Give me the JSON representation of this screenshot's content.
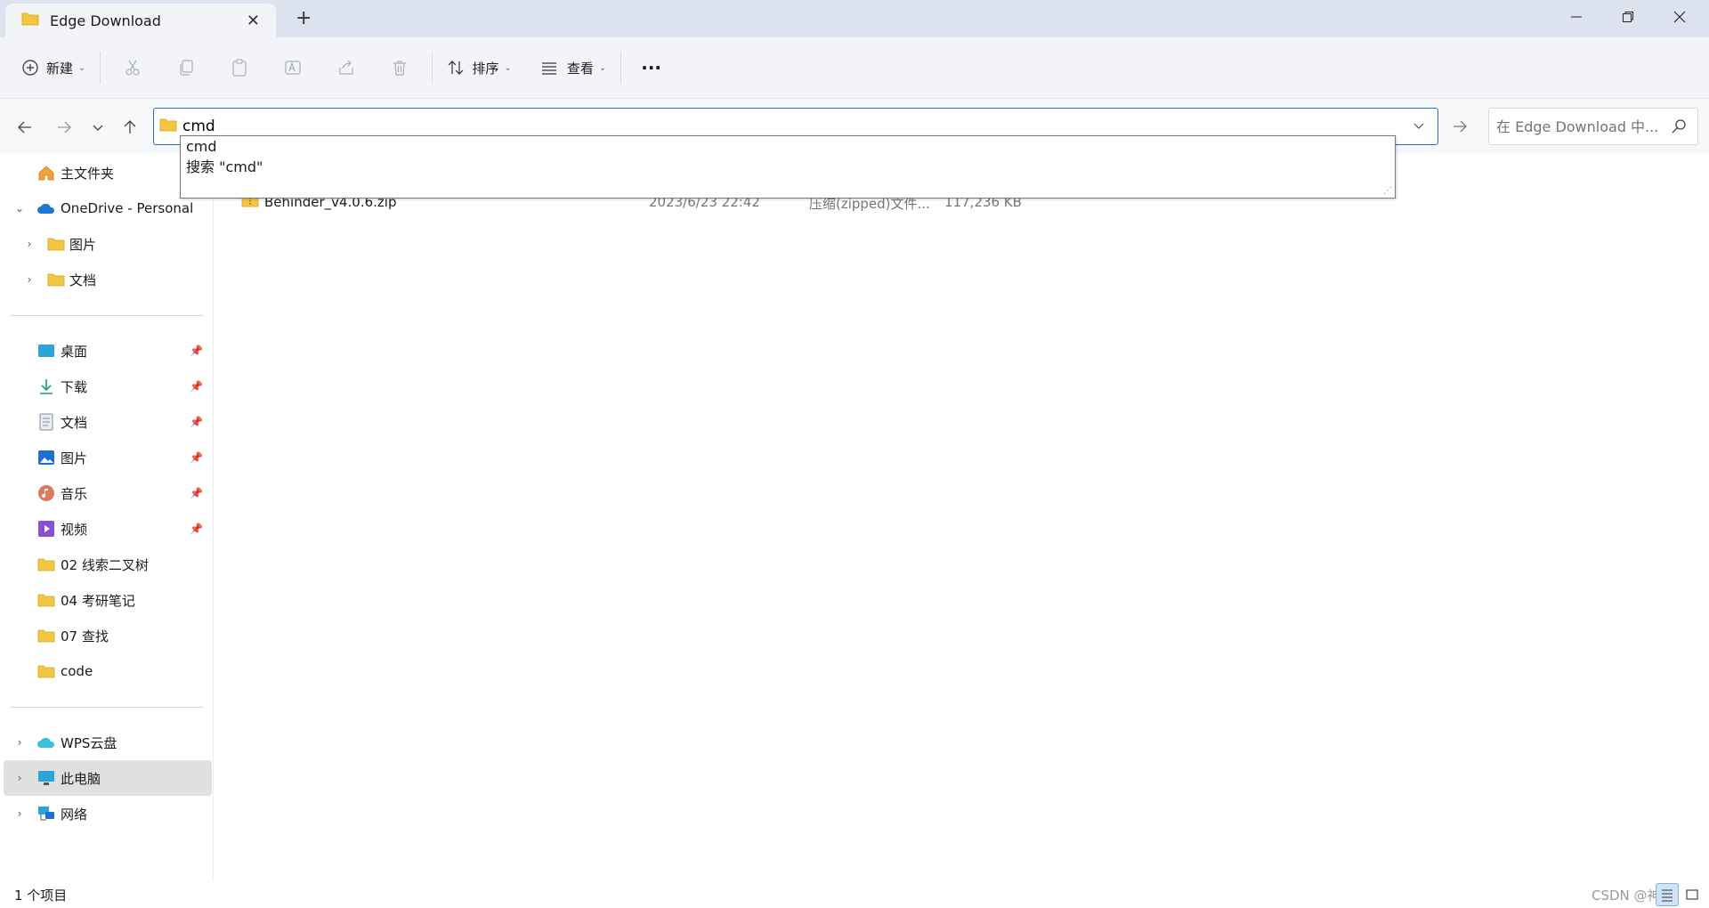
{
  "window": {
    "tab_title": "Edge Download",
    "new_tab_glyph": "+",
    "close_tab_glyph": "✕"
  },
  "toolbar": {
    "new_label": "新建",
    "sort_label": "排序",
    "view_label": "查看",
    "more_glyph": "···"
  },
  "address": {
    "value": "cmd"
  },
  "search": {
    "placeholder": "在 Edge Download 中..."
  },
  "autocomplete": {
    "items": [
      "cmd",
      "搜索 \"cmd\""
    ]
  },
  "sidebar": {
    "home": "主文件夹",
    "onedrive": "OneDrive - Personal",
    "od_pictures": "图片",
    "od_documents": "文档",
    "desktop": "桌面",
    "downloads": "下载",
    "documents": "文档",
    "pictures": "图片",
    "music": "音乐",
    "videos": "视频",
    "folder1": "02 线索二叉树",
    "folder2": "04 考研笔记",
    "folder3": "07 查找",
    "folder4": "code",
    "wps": "WPS云盘",
    "thispc": "此电脑",
    "network": "网络"
  },
  "files": [
    {
      "name": "Behinder_v4.0.6.zip",
      "date": "2023/6/23 22:42",
      "type": "压缩(zipped)文件...",
      "size": "117,236 KB"
    }
  ],
  "status": {
    "count": "1 个项目",
    "watermark": "CSDN @神奇"
  },
  "colors": {
    "accent": "#1c6fd0",
    "folder": "#f4c542",
    "titlebar": "#dce3ef",
    "toolbar": "#f3f4f7"
  }
}
